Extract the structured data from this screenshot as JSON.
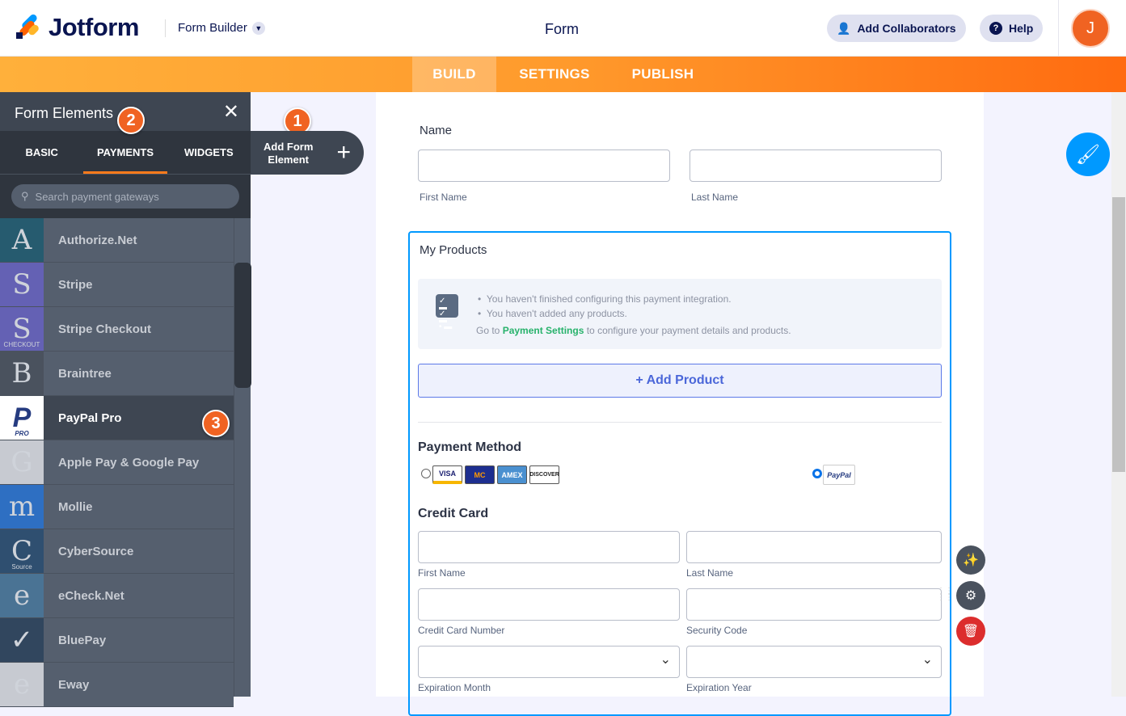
{
  "header": {
    "brand": "Jotform",
    "builder": "Form Builder",
    "title": "Form",
    "collaborators": "Add Collaborators",
    "help": "Help",
    "avatar": "J"
  },
  "nav": {
    "tabs": [
      "BUILD",
      "SETTINGS",
      "PUBLISH"
    ],
    "active": "BUILD"
  },
  "sidebar": {
    "title": "Form Elements",
    "tabs": [
      "BASIC",
      "PAYMENTS",
      "WIDGETS"
    ],
    "active_tab": "PAYMENTS",
    "search_placeholder": "Search payment gateways",
    "items": [
      {
        "label": "Authorize.Net",
        "icon": "A",
        "color": "#265b6f"
      },
      {
        "label": "Stripe",
        "icon": "S",
        "color": "#6461b4"
      },
      {
        "label": "Stripe Checkout",
        "icon": "S",
        "sub": "CHECKOUT",
        "color": "#6461b4"
      },
      {
        "label": "Braintree",
        "icon": "B",
        "color": "#4a525e"
      },
      {
        "label": "PayPal Pro",
        "icon": "P",
        "sub": "PRO",
        "color": "#ffffff"
      },
      {
        "label": "Apple Pay & Google Pay",
        "icon": "G",
        "color": "#c7cad1"
      },
      {
        "label": "Mollie",
        "icon": "m",
        "color": "#2e6fc2"
      },
      {
        "label": "CyberSource",
        "icon": "C",
        "sub": "Source",
        "color": "#2f4f70"
      },
      {
        "label": "eCheck.Net",
        "icon": "e",
        "color": "#4a7394"
      },
      {
        "label": "BluePay",
        "icon": "✓",
        "color": "#31465e"
      },
      {
        "label": "Eway",
        "icon": "e",
        "color": "#c7cad1"
      }
    ]
  },
  "badges": [
    "1",
    "2",
    "3"
  ],
  "add_element": {
    "line1": "Add Form",
    "line2": "Element"
  },
  "form": {
    "name_label": "Name",
    "first_name": "First Name",
    "last_name": "Last Name",
    "products_label": "My Products",
    "warn1": "You haven't finished configuring this payment integration.",
    "warn2": "You haven't added any products.",
    "warn3_pre": "Go to ",
    "warn3_link": "Payment Settings",
    "warn3_post": " to configure your payment details and products.",
    "add_product": "+ Add Product",
    "payment_method": "Payment Method",
    "cards": [
      "VISA",
      "MC",
      "AMEX",
      "DISCOVER"
    ],
    "paypal": "PayPal",
    "credit_card": "Credit Card",
    "cc_first": "First Name",
    "cc_last": "Last Name",
    "cc_number": "Credit Card Number",
    "cc_code": "Security Code",
    "exp_month": "Expiration Month",
    "exp_year": "Expiration Year"
  }
}
